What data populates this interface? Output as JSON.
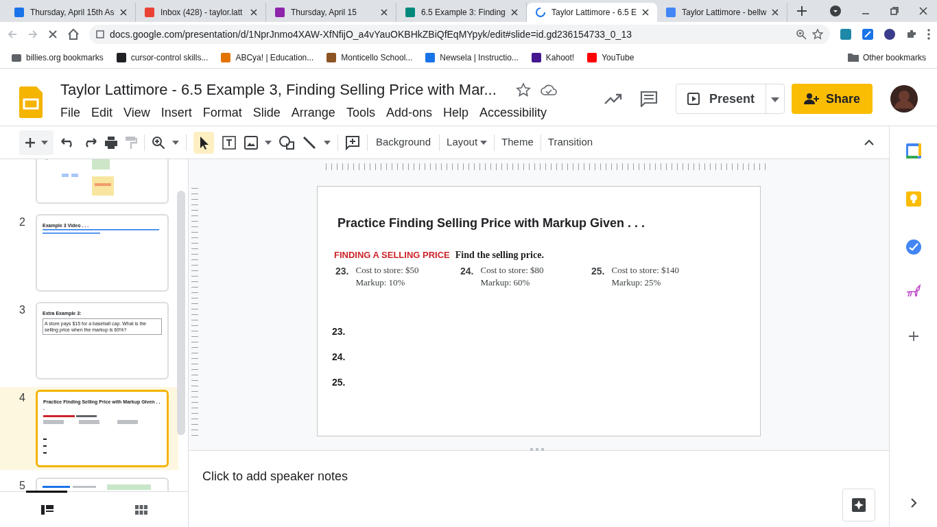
{
  "browser_tabs": [
    {
      "title": "Thursday, April 15th As",
      "color": "#1a73e8",
      "selected": false
    },
    {
      "title": "Inbox (428) - taylor.latt",
      "color": "#ea4335",
      "selected": false
    },
    {
      "title": "Thursday, April 15",
      "color": "#8e24aa",
      "selected": false
    },
    {
      "title": "6.5 Example 3: Finding",
      "color": "#00897b",
      "selected": false
    },
    {
      "title": "Taylor Lattimore - 6.5 E",
      "color": "#1a73e8",
      "selected": true
    },
    {
      "title": "Taylor Lattimore - bellw",
      "color": "#4285f4",
      "selected": false
    }
  ],
  "address": "docs.google.com/presentation/d/1NprJnmo4XAW-XfNfijO_a4vYauOKBHkZBiQfEqMYpyk/edit#slide=id.gd236154733_0_13",
  "bookmarks": [
    "billies.org bookmarks",
    "cursor-control skills...",
    "ABCya! | Education...",
    "Monticello School...",
    "Newsela | Instructio...",
    "Kahoot!",
    "YouTube"
  ],
  "other_bookmarks": "Other bookmarks",
  "doc_title": "Taylor Lattimore - 6.5 Example 3, Finding Selling Price with Mar...",
  "menu": [
    "File",
    "Edit",
    "View",
    "Insert",
    "Format",
    "Slide",
    "Arrange",
    "Tools",
    "Add-ons",
    "Help",
    "Accessibility"
  ],
  "present": "Present",
  "share": "Share",
  "toolbar_texts": [
    "Background",
    "Layout",
    "Theme",
    "Transition"
  ],
  "slides": [
    {
      "selected": false
    },
    {
      "number": "2",
      "title": "Example 3 Video . . .",
      "selected": false
    },
    {
      "number": "3",
      "title": "Extra Example 3:",
      "body": "A store pays $15 for a baseball cap.  What is the selling price when the markup is 60%?",
      "selected": false
    },
    {
      "number": "4",
      "title": "Practice Finding Selling Price with Markup Given . . .",
      "selected": true
    },
    {
      "number": "5",
      "selected": false
    }
  ],
  "slide": {
    "title": "Practice Finding Selling Price with Markup Given . . .",
    "section": "FINDING A SELLING PRICE",
    "instruction": "Find the selling price.",
    "problems": [
      {
        "number": "23.",
        "lines": [
          "Cost to store: $50",
          "Markup: 10%"
        ]
      },
      {
        "number": "24.",
        "lines": [
          "Cost to store: $80",
          "Markup: 60%"
        ]
      },
      {
        "number": "25.",
        "lines": [
          "Cost to store: $140",
          "Markup: 25%"
        ]
      }
    ],
    "answers": [
      "23.",
      "24.",
      "25."
    ]
  },
  "speaker_notes": {
    "placeholder": "Click to add speaker notes"
  }
}
